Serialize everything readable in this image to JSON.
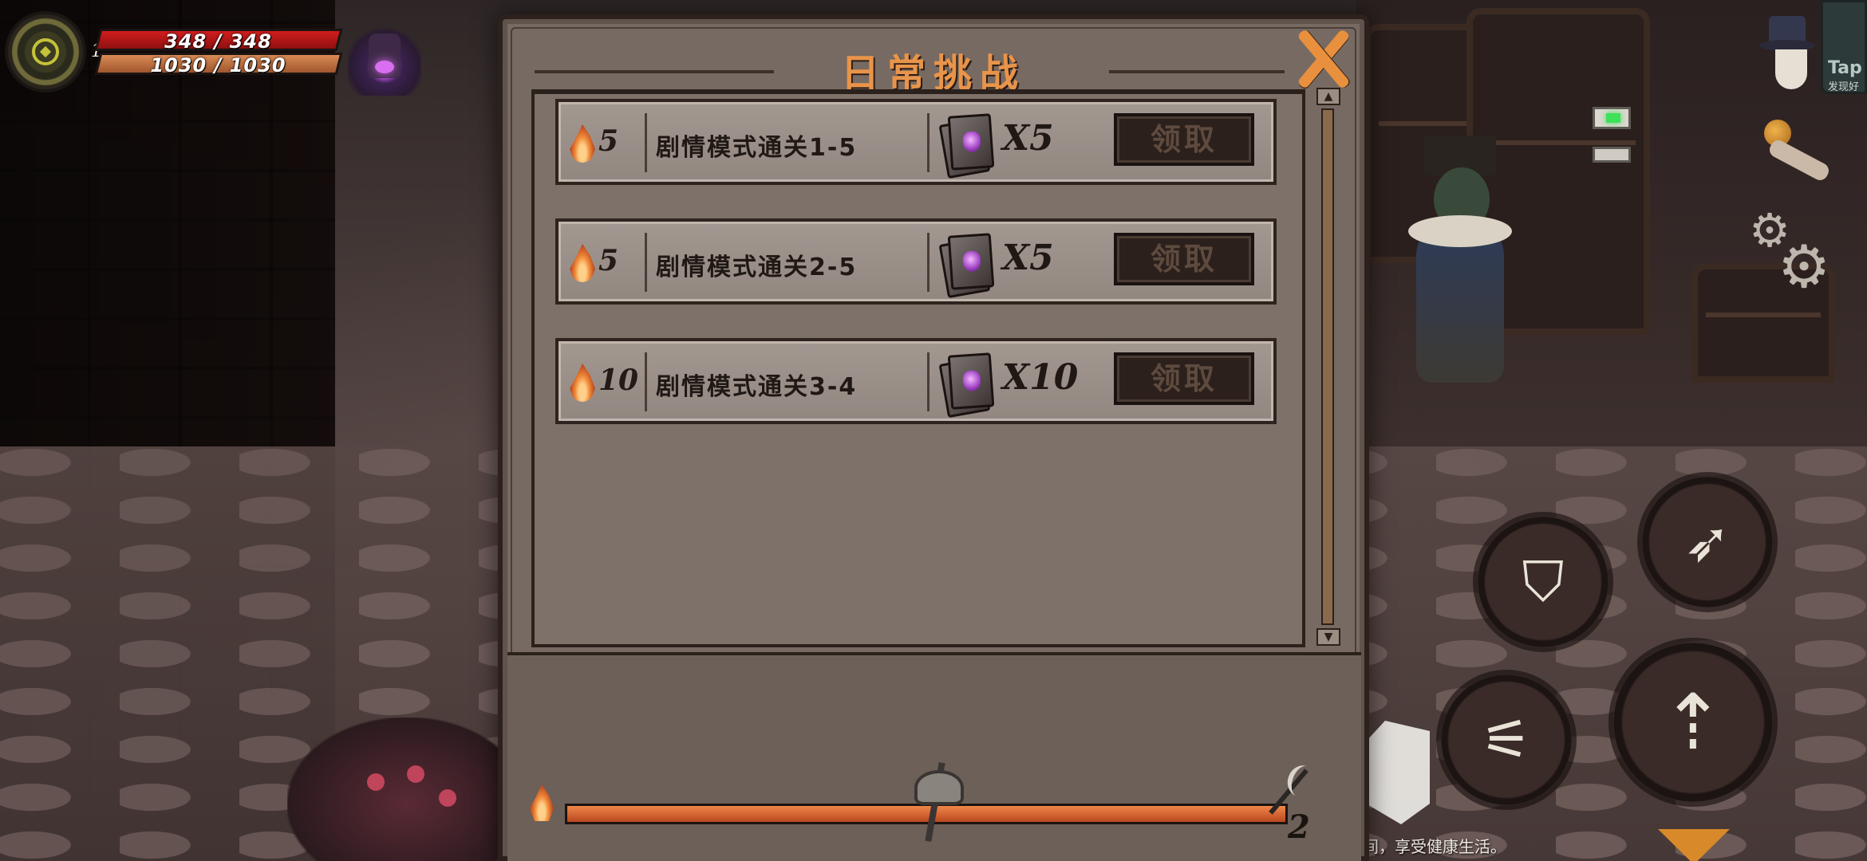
{
  "hud": {
    "level": "1",
    "hp_text": "348 / 348",
    "mp_text": "1030 / 1030",
    "hp_color": "#d21d1d",
    "mp_color": "#d98a55"
  },
  "taptap": {
    "label": "Tap",
    "sub": "发现好"
  },
  "panel": {
    "title": "日常挑战",
    "title_color": "#e8944a",
    "close_icon": "close-icon",
    "tasks": [
      {
        "points": "5",
        "name": "剧情模式通关1-5",
        "reward_icon": "purple-gem-book-icon",
        "reward_qty": "X5",
        "claim_label": "领取"
      },
      {
        "points": "5",
        "name": "剧情模式通关2-5",
        "reward_icon": "purple-gem-book-icon",
        "reward_qty": "X5",
        "claim_label": "领取"
      },
      {
        "points": "10",
        "name": "剧情模式通关3-4",
        "reward_icon": "purple-gem-book-icon",
        "reward_qty": "X10",
        "claim_label": "领取"
      }
    ],
    "progress": {
      "fraction": 1.0,
      "count": "2",
      "fill_color": "#f0874a"
    }
  },
  "footer_tip": "间，享受健康生活。",
  "controls": {
    "skills": [
      "shield-skill-icon",
      "dash-skill-icon",
      "claw-skill-icon",
      "spear-attack-icon"
    ],
    "settings_icon": "gear-icon",
    "hat_icon": "detective-hat-icon"
  }
}
